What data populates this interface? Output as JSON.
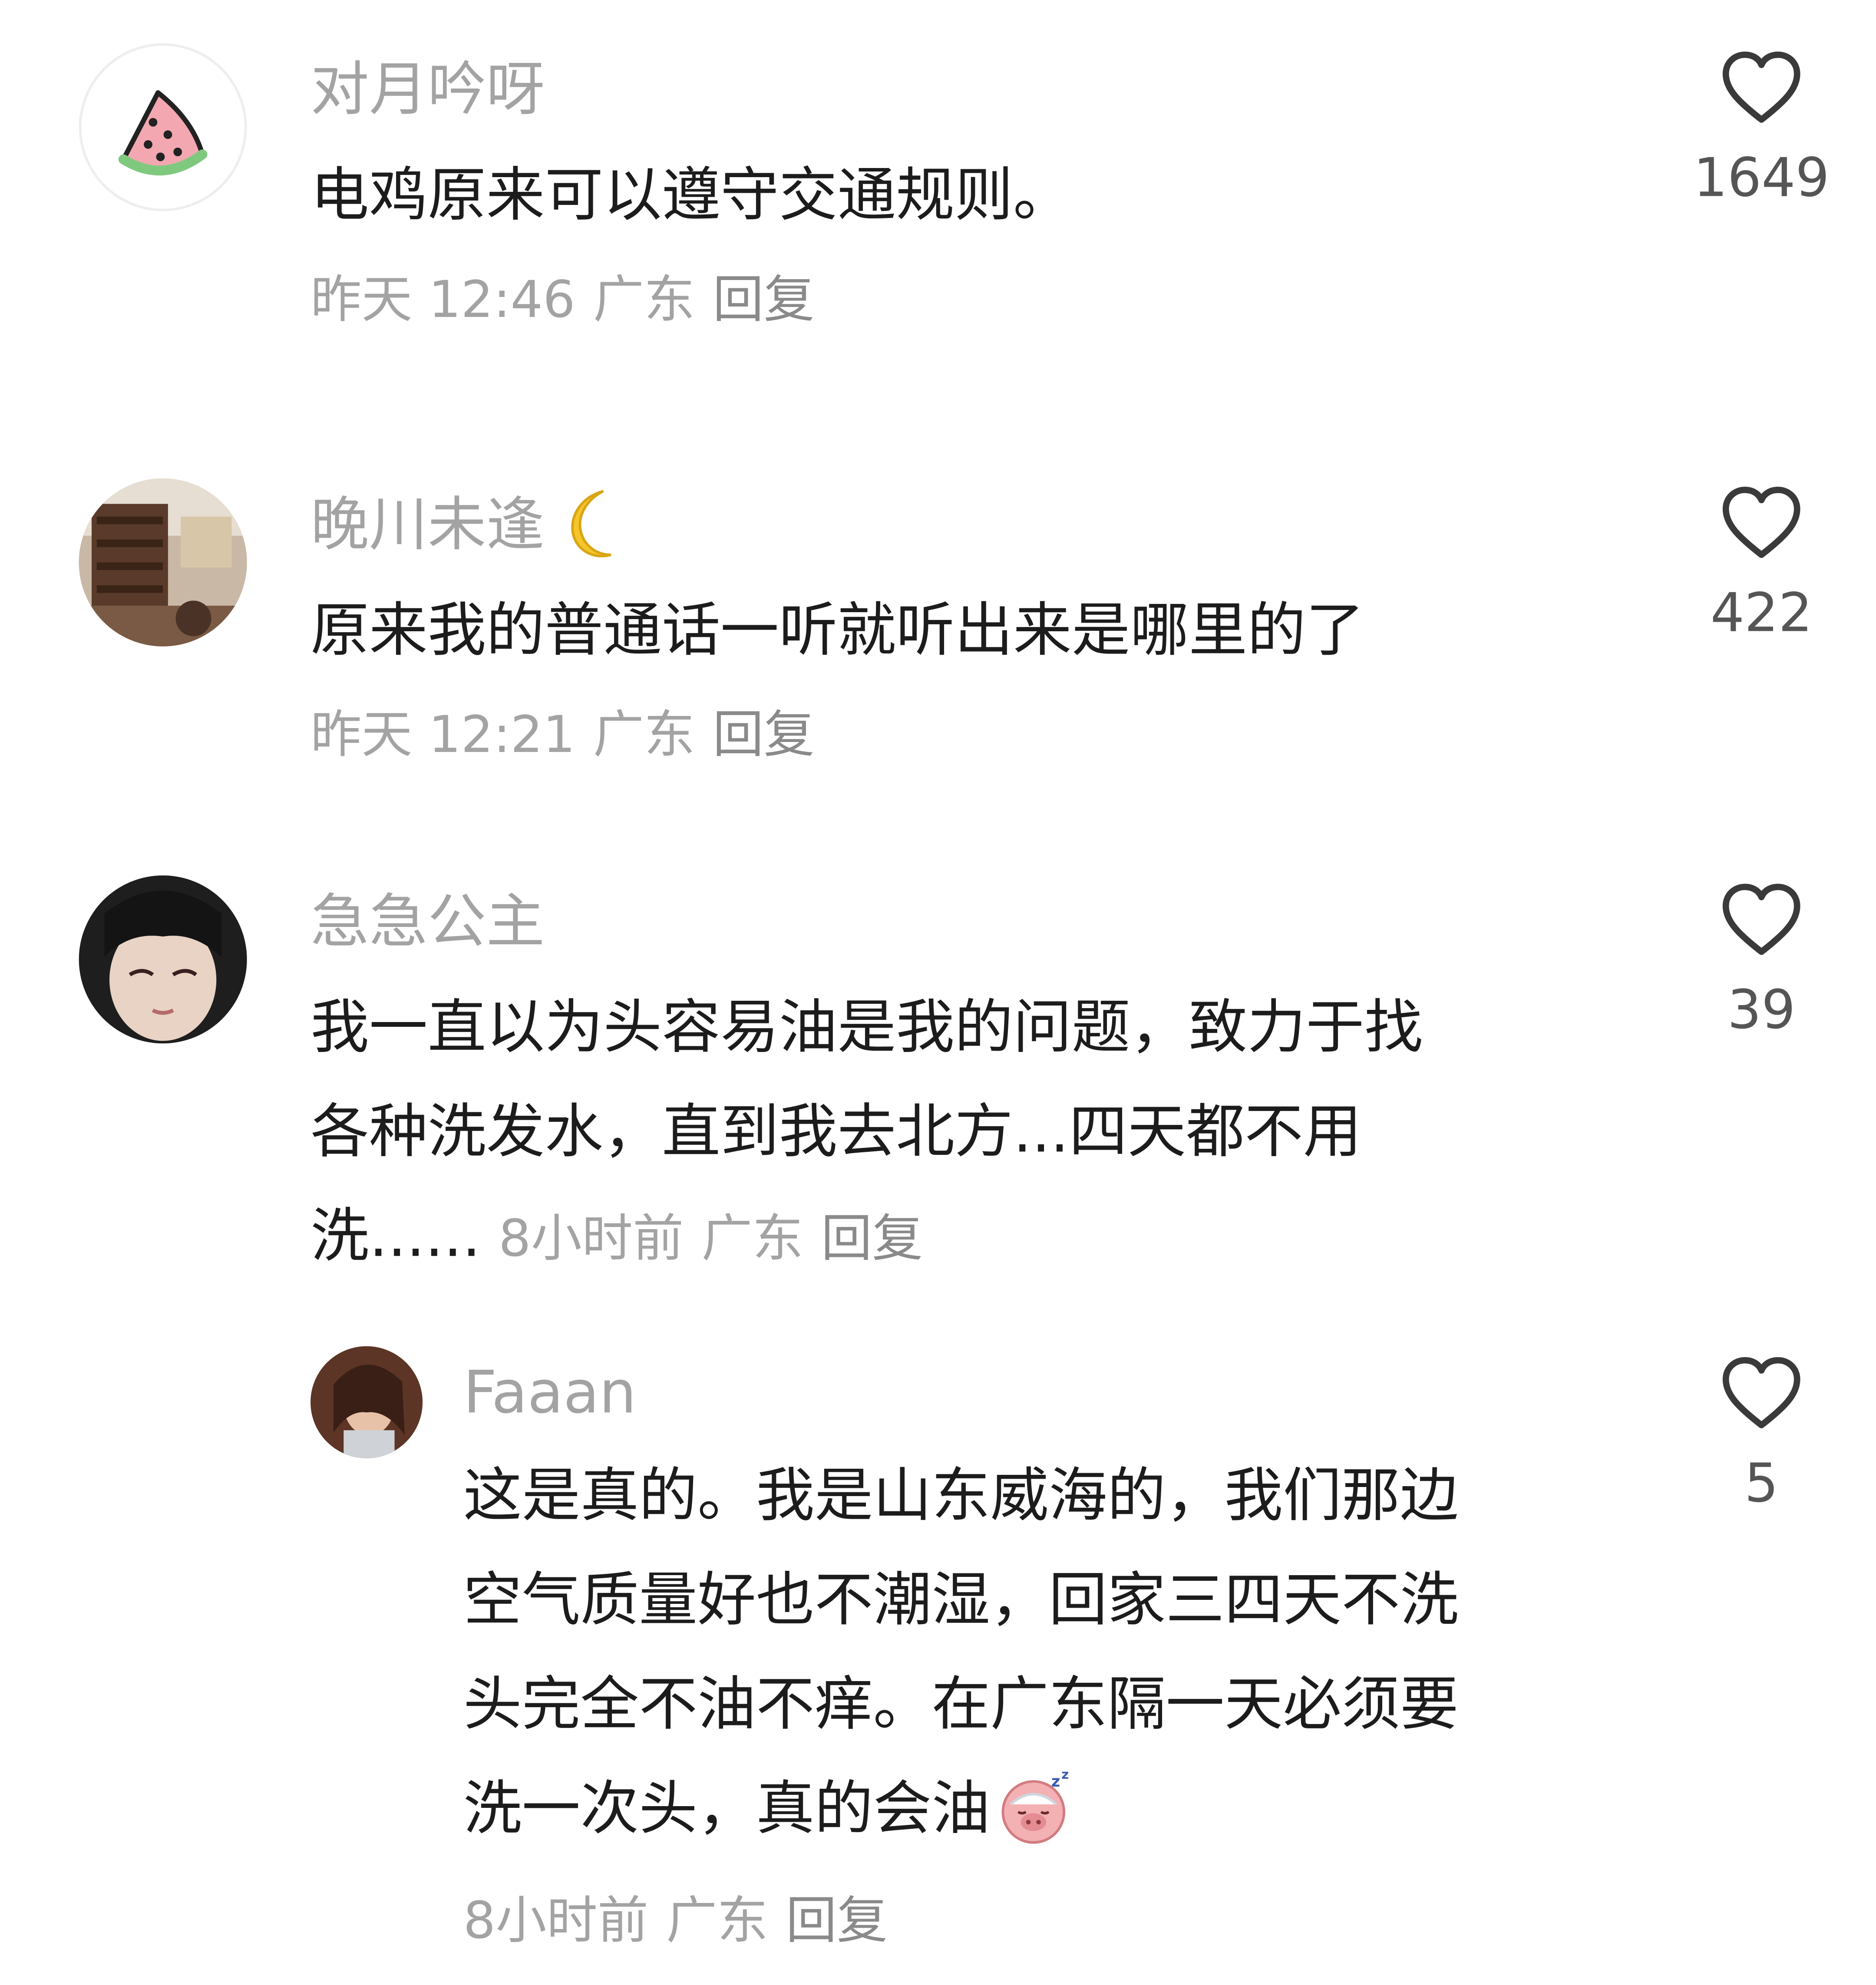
{
  "comments": [
    {
      "username": "对月吟呀",
      "text": "电鸡原来可以遵守交通规则。",
      "time": "昨天 12:46",
      "location": "广东",
      "reply": "回复",
      "likes": "1649"
    },
    {
      "username": "晚川未逢",
      "text": "原来我的普通话一听就听出来是哪里的了",
      "time": "昨天 12:21",
      "location": "广东",
      "reply": "回复",
      "likes": "422"
    },
    {
      "username": "急急公主",
      "text_lines": [
        "我一直以为头容易油是我的问题，致力于找",
        "各种洗发水，直到我去北方...四天都不用",
        "洗......"
      ],
      "time": "8小时前",
      "location": "广东",
      "reply": "回复",
      "likes": "39"
    },
    {
      "username": "Faaan",
      "text_lines": [
        "这是真的。我是山东威海的，我们那边",
        "空气质量好也不潮湿，回家三四天不洗",
        "头完全不油不痒。在广东隔一天必须要",
        "洗一次头，真的会油"
      ],
      "time": "8小时前",
      "location": "广东",
      "reply": "回复",
      "likes": "5"
    }
  ],
  "icons": {
    "like": "heart-outline-icon",
    "moon": "crescent-moon-emoji",
    "sleepy_pig": "sleepy-pig-emoji"
  }
}
